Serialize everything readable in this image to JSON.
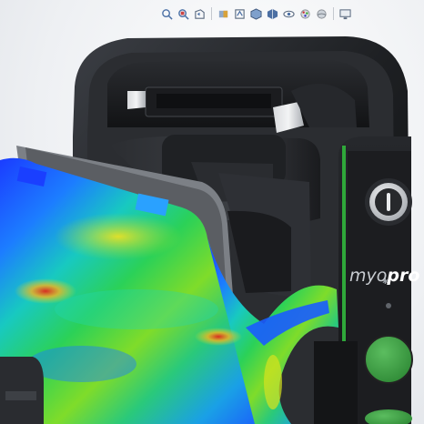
{
  "window": {
    "title": ""
  },
  "toolbar": {
    "buttons": [
      {
        "icon": "zoom-to-fit-icon"
      },
      {
        "icon": "zoom-to-area-icon"
      },
      {
        "icon": "previous-view-icon"
      },
      {
        "icon": "section-view-icon"
      },
      {
        "icon": "dynamic-annotation-view-icon"
      },
      {
        "icon": "view-orientation-icon"
      },
      {
        "icon": "display-style-icon"
      },
      {
        "icon": "hide-show-items-icon"
      },
      {
        "icon": "edit-appearance-icon"
      },
      {
        "icon": "apply-scene-icon"
      },
      {
        "icon": "view-settings-icon"
      }
    ]
  },
  "device": {
    "brand_prefix": "myo",
    "brand_suffix": "pro",
    "power_button_icon": "power-icon",
    "led_color": "#2fa83a",
    "button_color": "#3f9e45"
  },
  "colors": {
    "housing": "#1f2124",
    "housing_edge": "#3a3d42",
    "accent_green": "#3cb043"
  }
}
